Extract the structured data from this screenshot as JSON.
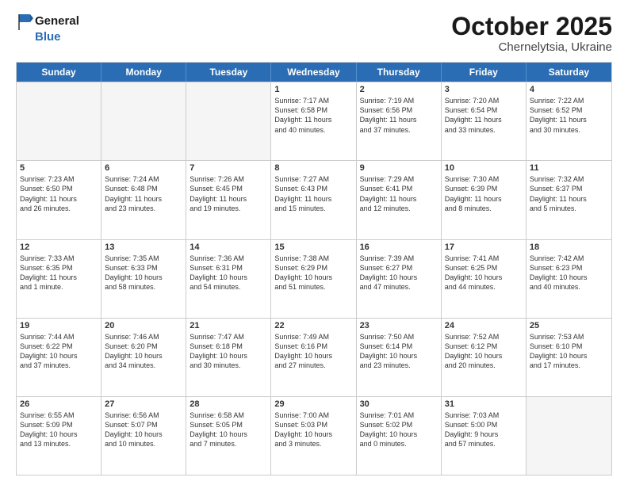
{
  "header": {
    "logo_line1": "General",
    "logo_line2": "Blue",
    "month": "October 2025",
    "location": "Chernelytsia, Ukraine"
  },
  "weekdays": [
    "Sunday",
    "Monday",
    "Tuesday",
    "Wednesday",
    "Thursday",
    "Friday",
    "Saturday"
  ],
  "rows": [
    [
      {
        "day": "",
        "lines": [],
        "empty": true
      },
      {
        "day": "",
        "lines": [],
        "empty": true
      },
      {
        "day": "",
        "lines": [],
        "empty": true
      },
      {
        "day": "1",
        "lines": [
          "Sunrise: 7:17 AM",
          "Sunset: 6:58 PM",
          "Daylight: 11 hours",
          "and 40 minutes."
        ]
      },
      {
        "day": "2",
        "lines": [
          "Sunrise: 7:19 AM",
          "Sunset: 6:56 PM",
          "Daylight: 11 hours",
          "and 37 minutes."
        ]
      },
      {
        "day": "3",
        "lines": [
          "Sunrise: 7:20 AM",
          "Sunset: 6:54 PM",
          "Daylight: 11 hours",
          "and 33 minutes."
        ]
      },
      {
        "day": "4",
        "lines": [
          "Sunrise: 7:22 AM",
          "Sunset: 6:52 PM",
          "Daylight: 11 hours",
          "and 30 minutes."
        ]
      }
    ],
    [
      {
        "day": "5",
        "lines": [
          "Sunrise: 7:23 AM",
          "Sunset: 6:50 PM",
          "Daylight: 11 hours",
          "and 26 minutes."
        ]
      },
      {
        "day": "6",
        "lines": [
          "Sunrise: 7:24 AM",
          "Sunset: 6:48 PM",
          "Daylight: 11 hours",
          "and 23 minutes."
        ]
      },
      {
        "day": "7",
        "lines": [
          "Sunrise: 7:26 AM",
          "Sunset: 6:45 PM",
          "Daylight: 11 hours",
          "and 19 minutes."
        ]
      },
      {
        "day": "8",
        "lines": [
          "Sunrise: 7:27 AM",
          "Sunset: 6:43 PM",
          "Daylight: 11 hours",
          "and 15 minutes."
        ]
      },
      {
        "day": "9",
        "lines": [
          "Sunrise: 7:29 AM",
          "Sunset: 6:41 PM",
          "Daylight: 11 hours",
          "and 12 minutes."
        ]
      },
      {
        "day": "10",
        "lines": [
          "Sunrise: 7:30 AM",
          "Sunset: 6:39 PM",
          "Daylight: 11 hours",
          "and 8 minutes."
        ]
      },
      {
        "day": "11",
        "lines": [
          "Sunrise: 7:32 AM",
          "Sunset: 6:37 PM",
          "Daylight: 11 hours",
          "and 5 minutes."
        ]
      }
    ],
    [
      {
        "day": "12",
        "lines": [
          "Sunrise: 7:33 AM",
          "Sunset: 6:35 PM",
          "Daylight: 11 hours",
          "and 1 minute."
        ]
      },
      {
        "day": "13",
        "lines": [
          "Sunrise: 7:35 AM",
          "Sunset: 6:33 PM",
          "Daylight: 10 hours",
          "and 58 minutes."
        ]
      },
      {
        "day": "14",
        "lines": [
          "Sunrise: 7:36 AM",
          "Sunset: 6:31 PM",
          "Daylight: 10 hours",
          "and 54 minutes."
        ]
      },
      {
        "day": "15",
        "lines": [
          "Sunrise: 7:38 AM",
          "Sunset: 6:29 PM",
          "Daylight: 10 hours",
          "and 51 minutes."
        ]
      },
      {
        "day": "16",
        "lines": [
          "Sunrise: 7:39 AM",
          "Sunset: 6:27 PM",
          "Daylight: 10 hours",
          "and 47 minutes."
        ]
      },
      {
        "day": "17",
        "lines": [
          "Sunrise: 7:41 AM",
          "Sunset: 6:25 PM",
          "Daylight: 10 hours",
          "and 44 minutes."
        ]
      },
      {
        "day": "18",
        "lines": [
          "Sunrise: 7:42 AM",
          "Sunset: 6:23 PM",
          "Daylight: 10 hours",
          "and 40 minutes."
        ]
      }
    ],
    [
      {
        "day": "19",
        "lines": [
          "Sunrise: 7:44 AM",
          "Sunset: 6:22 PM",
          "Daylight: 10 hours",
          "and 37 minutes."
        ]
      },
      {
        "day": "20",
        "lines": [
          "Sunrise: 7:46 AM",
          "Sunset: 6:20 PM",
          "Daylight: 10 hours",
          "and 34 minutes."
        ]
      },
      {
        "day": "21",
        "lines": [
          "Sunrise: 7:47 AM",
          "Sunset: 6:18 PM",
          "Daylight: 10 hours",
          "and 30 minutes."
        ]
      },
      {
        "day": "22",
        "lines": [
          "Sunrise: 7:49 AM",
          "Sunset: 6:16 PM",
          "Daylight: 10 hours",
          "and 27 minutes."
        ]
      },
      {
        "day": "23",
        "lines": [
          "Sunrise: 7:50 AM",
          "Sunset: 6:14 PM",
          "Daylight: 10 hours",
          "and 23 minutes."
        ]
      },
      {
        "day": "24",
        "lines": [
          "Sunrise: 7:52 AM",
          "Sunset: 6:12 PM",
          "Daylight: 10 hours",
          "and 20 minutes."
        ]
      },
      {
        "day": "25",
        "lines": [
          "Sunrise: 7:53 AM",
          "Sunset: 6:10 PM",
          "Daylight: 10 hours",
          "and 17 minutes."
        ]
      }
    ],
    [
      {
        "day": "26",
        "lines": [
          "Sunrise: 6:55 AM",
          "Sunset: 5:09 PM",
          "Daylight: 10 hours",
          "and 13 minutes."
        ]
      },
      {
        "day": "27",
        "lines": [
          "Sunrise: 6:56 AM",
          "Sunset: 5:07 PM",
          "Daylight: 10 hours",
          "and 10 minutes."
        ]
      },
      {
        "day": "28",
        "lines": [
          "Sunrise: 6:58 AM",
          "Sunset: 5:05 PM",
          "Daylight: 10 hours",
          "and 7 minutes."
        ]
      },
      {
        "day": "29",
        "lines": [
          "Sunrise: 7:00 AM",
          "Sunset: 5:03 PM",
          "Daylight: 10 hours",
          "and 3 minutes."
        ]
      },
      {
        "day": "30",
        "lines": [
          "Sunrise: 7:01 AM",
          "Sunset: 5:02 PM",
          "Daylight: 10 hours",
          "and 0 minutes."
        ]
      },
      {
        "day": "31",
        "lines": [
          "Sunrise: 7:03 AM",
          "Sunset: 5:00 PM",
          "Daylight: 9 hours",
          "and 57 minutes."
        ]
      },
      {
        "day": "",
        "lines": [],
        "empty": true
      }
    ]
  ]
}
